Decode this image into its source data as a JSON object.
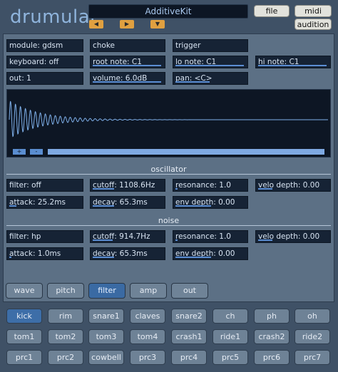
{
  "header": {
    "app_title": "drumular",
    "kit_name": "AdditiveKit",
    "file_label": "file",
    "midi_learn_label": "midi learn",
    "audition_label": "audition",
    "arrows": [
      "◀",
      "▶",
      "▼"
    ]
  },
  "main": {
    "module": "module: gdsm",
    "choke": "choke",
    "trigger": "trigger",
    "keyboard": "keyboard: off",
    "root_note": "root note: C1",
    "lo_note": "lo note: C1",
    "hi_note": "hi note: C1",
    "out": "out: 1",
    "volume": "volume: 6.0dB",
    "pan": "pan: <C>"
  },
  "zoom": {
    "plus": "+",
    "minus": "-"
  },
  "oscillator": {
    "title": "oscillator",
    "filter": "filter: off",
    "cutoff": "cutoff: 1108.6Hz",
    "resonance": "resonance: 1.0",
    "velo_depth": "velo depth: 0.00",
    "attack": "attack: 25.2ms",
    "decay": "decay: 65.3ms",
    "env_depth": "env depth: 0.00"
  },
  "noise": {
    "title": "noise",
    "filter": "filter: hp",
    "cutoff": "cutoff: 914.7Hz",
    "resonance": "resonance: 1.0",
    "velo_depth": "velo depth: 0.00",
    "attack": "attack: 1.0ms",
    "decay": "decay: 65.3ms",
    "env_depth": "env depth: 0.00"
  },
  "tabs": [
    "wave",
    "pitch",
    "filter",
    "amp",
    "out"
  ],
  "active_tab": "filter",
  "pads": [
    "kick",
    "rim",
    "snare1",
    "claves",
    "snare2",
    "ch",
    "ph",
    "oh",
    "tom1",
    "tom2",
    "tom3",
    "tom4",
    "crash1",
    "ride1",
    "crash2",
    "ride2",
    "prc1",
    "prc2",
    "cowbell",
    "prc3",
    "prc4",
    "prc5",
    "prc6",
    "prc7"
  ],
  "active_pad": "kick",
  "colors": {
    "accent": "#5b8ed4",
    "background": "#3f5166",
    "field": "#162335",
    "arrow": "#e0a040"
  }
}
